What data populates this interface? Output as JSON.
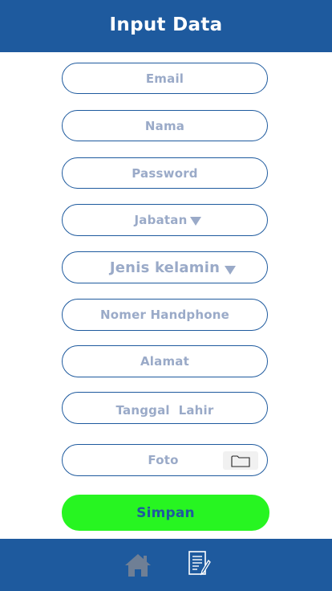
{
  "header": {
    "title": "Input Data"
  },
  "form": {
    "email": {
      "placeholder": "Email"
    },
    "nama": {
      "placeholder": "Nama"
    },
    "password": {
      "placeholder": "Password"
    },
    "jabatan": {
      "placeholder": "Jabatan"
    },
    "jenis_kelamin": {
      "placeholder": "Jenis kelamin"
    },
    "handphone": {
      "placeholder": "Nomer Handphone"
    },
    "alamat": {
      "placeholder": "Alamat"
    },
    "tanggal_lahir": {
      "placeholder": "Tanggal  Lahir"
    },
    "foto": {
      "placeholder": "Foto"
    },
    "submit_label": "Simpan"
  },
  "bottom_nav": {
    "items": [
      {
        "icon": "home-icon"
      },
      {
        "icon": "form-document-icon"
      }
    ]
  },
  "colors": {
    "primary": "#1e5a9e",
    "accent_button": "#27f521",
    "placeholder_text": "#9aaac8"
  }
}
